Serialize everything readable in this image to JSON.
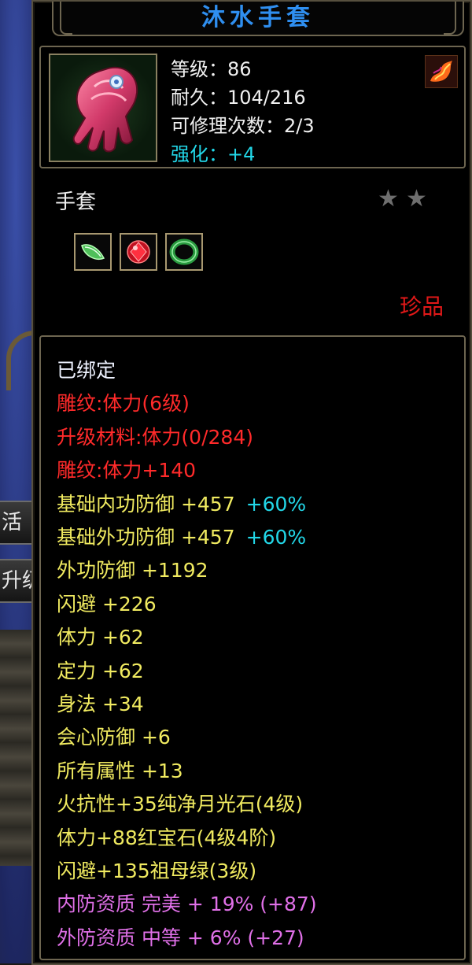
{
  "background": {
    "bar1_text": "活",
    "bar2_text": "升级"
  },
  "item": {
    "name": "沐水手套",
    "level": "等级：86",
    "durability": "耐久：104/216",
    "repair_count": "可修理次数：2/3",
    "enhance": "强化：+4",
    "type": "手套",
    "stars": [
      "★",
      "★"
    ],
    "gems": [
      "green-jade-icon",
      "ruby-gem-icon",
      "emerald-ring-icon"
    ],
    "rarity": "珍品",
    "icon": "gauntlet-icon",
    "badge_icon": "fire-dragon-icon"
  },
  "attributes": [
    {
      "text": "已绑定",
      "color": "white"
    },
    {
      "text": "雕纹:体力(6级)",
      "color": "red"
    },
    {
      "text": "升级材料:体力(0/284)",
      "color": "red"
    },
    {
      "text": "雕纹:体力+140",
      "color": "red"
    },
    {
      "text": "基础内功防御 +457",
      "extra": "+60%",
      "color": "yellow"
    },
    {
      "text": "基础外功防御 +457",
      "extra": "+60%",
      "color": "yellow"
    },
    {
      "text": "外功防御 +1192",
      "color": "yellow"
    },
    {
      "text": "闪避 +226",
      "color": "yellow"
    },
    {
      "text": "体力 +62",
      "color": "yellow"
    },
    {
      "text": "定力 +62",
      "color": "yellow"
    },
    {
      "text": "身法 +34",
      "color": "yellow"
    },
    {
      "text": "会心防御 +6",
      "color": "yellow"
    },
    {
      "text": "所有属性 +13",
      "color": "yellow"
    },
    {
      "text": "火抗性+35纯净月光石(4级)",
      "color": "yellow"
    },
    {
      "text": "体力+88红宝石(4级4阶)",
      "color": "yellow"
    },
    {
      "text": "闪避+135祖母绿(3级)",
      "color": "yellow"
    },
    {
      "text": "内防资质 完美 + 19% (+87)",
      "color": "pink"
    },
    {
      "text": "外防资质 中等 + 6% (+27)",
      "color": "pink"
    }
  ],
  "colors": {
    "title": "#2f8ff0",
    "enhance": "#22d7e8",
    "rarity": "#e01818",
    "red": "#ff2a2a",
    "yellow": "#f0ea60",
    "pink": "#e070e8",
    "white": "#eef2ff",
    "cyan": "#22d7e8"
  }
}
